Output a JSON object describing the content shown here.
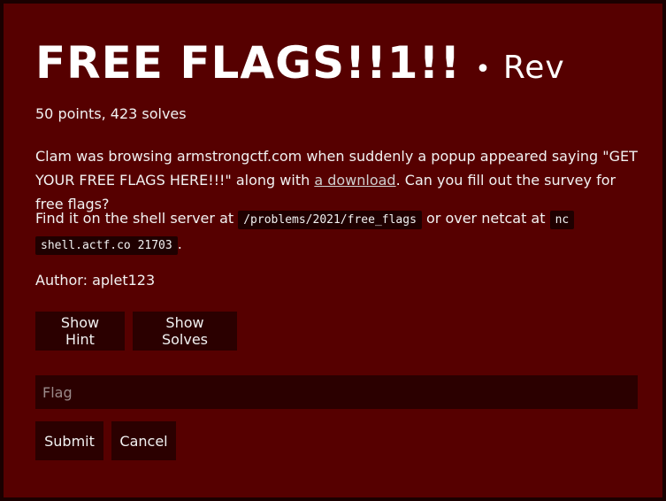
{
  "challenge": {
    "title": "FREE FLAGS!!1!!",
    "separator": "•",
    "category": "Rev",
    "meta": "50 points, 423 solves",
    "description": {
      "before_link": "Clam was browsing armstrongctf.com when suddenly a popup appeared saying \"GET YOUR FREE FLAGS HERE!!!\" along with ",
      "link_text": "a download",
      "after_link": ". Can you fill out the survey for free flags?"
    },
    "shell": {
      "prefix": "Find it on the shell server at ",
      "path": "/problems/2021/free_flags",
      "middle": " or over netcat at ",
      "netcat_line1": "nc",
      "netcat_line2": "shell.actf.co 21703",
      "suffix": "."
    },
    "author": "Author: aplet123"
  },
  "buttons": {
    "hint": "Show Hint",
    "solves": "Show Solves",
    "submit": "Submit",
    "cancel": "Cancel"
  },
  "flag_input": {
    "placeholder": "Flag",
    "value": ""
  }
}
